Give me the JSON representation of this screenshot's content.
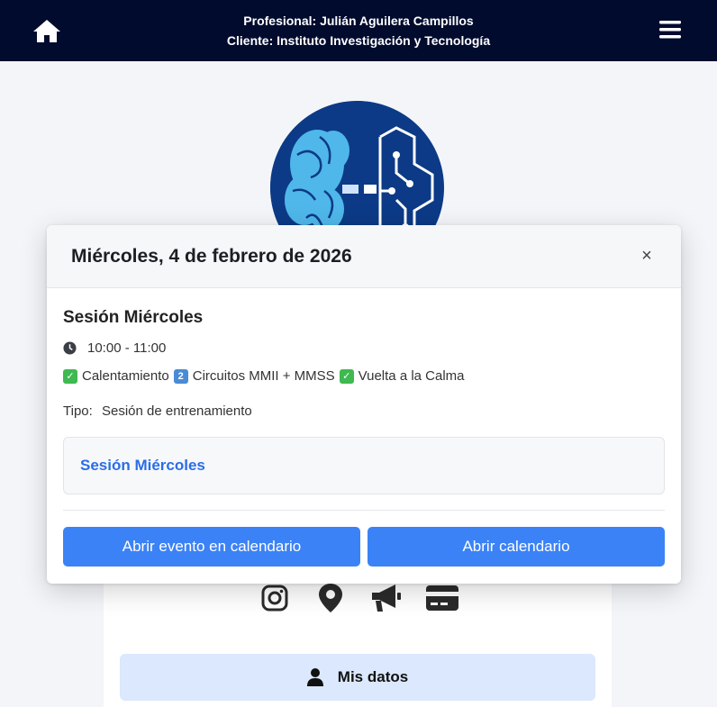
{
  "header": {
    "line1": "Profesional: Julián Aguilera Campillos",
    "line2": "Cliente: Instituto Investigación y Tecnología",
    "home_icon": "home-icon",
    "menu_icon": "hamburger-menu-icon"
  },
  "colors": {
    "header_bg": "#010b2e",
    "accent": "#3b82f6",
    "link": "#2a6ee6",
    "logo_bg": "#0c3a86"
  },
  "modal": {
    "title": "Miércoles, 4 de febrero de 2026",
    "close_label": "×",
    "session_title": "Sesión Miércoles",
    "time": "10:00 - 11:00",
    "description": {
      "item1": "Calentamiento",
      "item2_badge": "2",
      "item2": "Circuitos MMII + MMSS",
      "item3": "Vuelta a la Calma"
    },
    "tipo_label": "Tipo:",
    "tipo_value": "Sesión de entrenamiento",
    "event_link": "Sesión Miércoles",
    "buttons": {
      "open_event": "Abrir evento en calendario",
      "open_calendar": "Abrir calendario"
    }
  },
  "page": {
    "social_icons": [
      "instagram-icon",
      "location-icon",
      "megaphone-icon",
      "credit-card-icon"
    ],
    "mis_datos_label": "Mis datos"
  }
}
